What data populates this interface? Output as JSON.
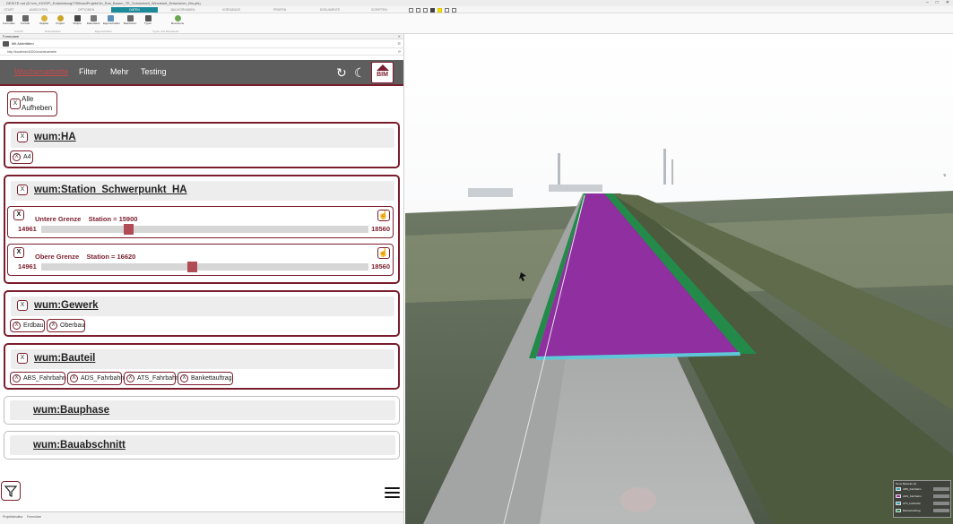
{
  "titlebar": {
    "text": "DESITE md (D:\\vm_KIOSP\\_Entwicklung\\TSB\\cadProjekt\\1b_Erw_Bauen_TE_Schulmiddl_Winzlstoß_Entwürmer_Bin.pfs)"
  },
  "ribbon_tabs": [
    {
      "label": "START"
    },
    {
      "label": "ANSICHTEN"
    },
    {
      "label": "OPTIONEN"
    },
    {
      "label": "DATEN"
    },
    {
      "label": "BAUVORHABEN"
    },
    {
      "label": "VORGÄNGE"
    },
    {
      "label": "PRÜFEN"
    },
    {
      "label": "DOKUMENTE"
    },
    {
      "label": "SCRIPTEN"
    }
  ],
  "ribbon": {
    "buttons": [
      {
        "label": "Formulare"
      },
      {
        "label": "Kontakt"
      },
      {
        "label": "Objekte"
      },
      {
        "label": "Projekt"
      },
      {
        "label": "Skripte"
      },
      {
        "label": "Datenbank"
      },
      {
        "label": "Eigenschaften"
      },
      {
        "label": "Bearbeiten"
      },
      {
        "label": "Typen"
      },
      {
        "label": "Messwerte"
      }
    ],
    "groups": [
      {
        "label": "Ansicht"
      },
      {
        "label": "Datenbanken"
      },
      {
        "label": "Eigenschaften"
      },
      {
        "label": "Typen und Messwerte"
      }
    ]
  },
  "panel": {
    "header": "Formulare",
    "subheader": "Mit Aktivitäten",
    "url": "http://localhost:4000/wochenarbeite"
  },
  "nav": {
    "items": [
      {
        "label": "Wochenarbeite",
        "active": true
      },
      {
        "label": "Filter"
      },
      {
        "label": "Mehr"
      },
      {
        "label": "Testing"
      }
    ],
    "refresh_icon": "↻",
    "theme_icon": "☾",
    "logo_text": "BIM"
  },
  "clear_all": {
    "x": "X",
    "label_line1": "Alle",
    "label_line2": "Aufheben"
  },
  "sections": {
    "ha": {
      "title": "wum:HA",
      "x": "X",
      "chips": [
        "A4"
      ]
    },
    "station": {
      "title": "wum:Station_Schwerpunkt_HA",
      "x": "X",
      "lower": {
        "label": "Untere Grenze",
        "value_label": "Station = 15900",
        "min": "14961",
        "max": "18560",
        "value": 15900,
        "range_min": 14961,
        "range_max": 18560
      },
      "upper": {
        "label": "Obere Grenze",
        "value_label": "Station = 16620",
        "min": "14961",
        "max": "18560",
        "value": 16620,
        "range_min": 14961,
        "range_max": 18560
      }
    },
    "gewerk": {
      "title": "wum:Gewerk",
      "x": "X",
      "chips": [
        "Erdbau",
        "Oberbau"
      ]
    },
    "bauteil": {
      "title": "wum:Bauteil",
      "x": "X",
      "chips": [
        "ABS_Fahrbahn",
        "ADS_Fahrbahn",
        "ATS_Fahrbahn",
        "Bankettauftrag"
      ]
    },
    "bauphase": {
      "title": "wum:Bauphase"
    },
    "bauabschnitt": {
      "title": "wum:Bauabschnitt"
    }
  },
  "bottom_tabs": [
    {
      "label": "Projektstruktur"
    },
    {
      "label": "Formulare"
    }
  ],
  "legend": {
    "title": "Neue Bauteile (4)",
    "items": [
      {
        "label": "ABS_Fahrbahn",
        "color": "#3aa6b6"
      },
      {
        "label": "ADS_Fahrbahn",
        "color": "#8f2fa0"
      },
      {
        "label": "ATS_Fahrbahn",
        "color": "#35a0b0"
      },
      {
        "label": "Bankettauftrag",
        "color": "#238a4a"
      }
    ]
  },
  "colors": {
    "accent": "#7a1d2c",
    "active_tab": "#1d8a9a",
    "nav_bg": "#5e5e5e",
    "slider_thumb": "#b14b55"
  }
}
